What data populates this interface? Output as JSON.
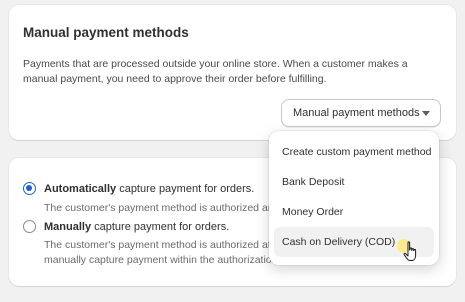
{
  "manual_card": {
    "title": "Manual payment methods",
    "description": "Payments that are processed outside your online store. When a customer makes a manual payment, you need to approve their order before fulfilling.",
    "dropdown_label": "Manual payment methods"
  },
  "dropdown_menu": {
    "items": [
      "Create custom payment method",
      "Bank Deposit",
      "Money Order",
      "Cash on Delivery (COD)"
    ],
    "hovered_item": "Cash on Delivery (COD)"
  },
  "capture_card": {
    "options": [
      {
        "bold": "Automatically",
        "rest": " capture payment for orders.",
        "help": "The customer's payment method is authorized and",
        "checked": true
      },
      {
        "bold": "Manually",
        "rest": " capture payment for orders.",
        "help": "The customer's payment method is authorized at the time of checkout. You need to manually capture payment within the authorization period.",
        "checked": false
      }
    ]
  },
  "colors": {
    "accent": "#1f5fd1",
    "background": "#f1f1f1",
    "card": "#ffffff",
    "cursor_highlight": "#ffe63c"
  },
  "icons": {
    "caret": "chevron-down-icon",
    "pointer": "hand-pointer-icon"
  }
}
